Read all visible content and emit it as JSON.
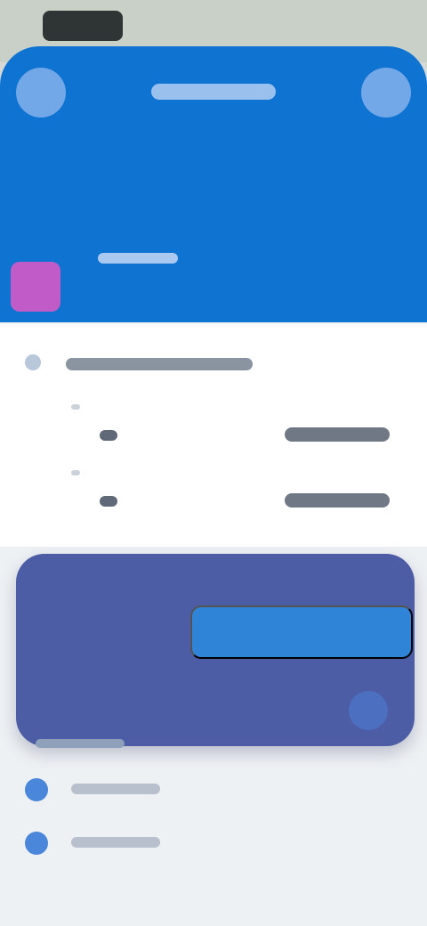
{
  "topbar": {
    "title": "",
    "left_icon": "circle-icon",
    "right_icon": "circle-icon"
  },
  "header": {
    "subtitle": "",
    "accent_color": "#0f73d2",
    "avatar_color": "#c05bc8"
  },
  "section": {
    "label": "",
    "icon": "info-icon",
    "chevron": "chevron-down-icon",
    "rows": [
      {
        "label": "",
        "value": ""
      },
      {
        "label": "",
        "value": ""
      }
    ]
  },
  "card": {
    "color": "#4c5da6",
    "primary_button_label": "",
    "action_icon": "arrow-icon",
    "footer_label": ""
  },
  "list": [
    {
      "icon": "globe-icon",
      "label": ""
    },
    {
      "icon": "globe-icon",
      "label": ""
    }
  ]
}
